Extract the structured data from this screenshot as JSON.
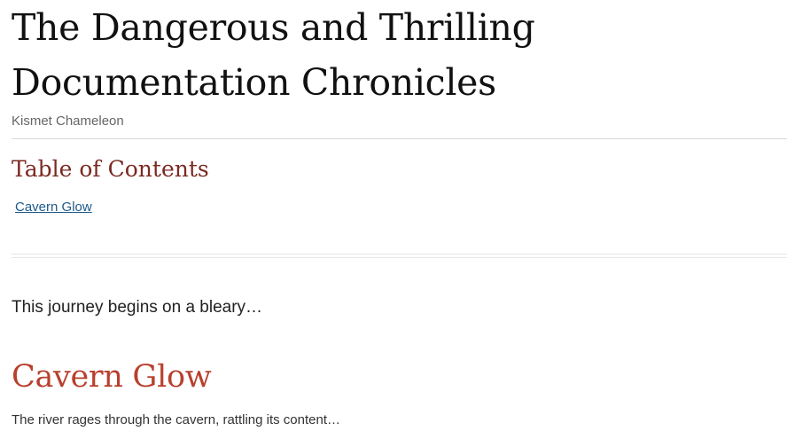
{
  "book": {
    "title": "The Dangerous and Thrilling Documentation Chronicles",
    "author": "Kismet Chameleon"
  },
  "toc": {
    "heading": "Table of Contents",
    "items": [
      {
        "label": "Cavern Glow"
      }
    ]
  },
  "intro": "This journey begins on a bleary…",
  "chapters": [
    {
      "title": "Cavern Glow",
      "text": "The river rages through the cavern, rattling its content…"
    }
  ],
  "colors": {
    "toc_heading": "#7a2a22",
    "chapter_title": "#b8402e",
    "link": "#1e5a8a"
  }
}
